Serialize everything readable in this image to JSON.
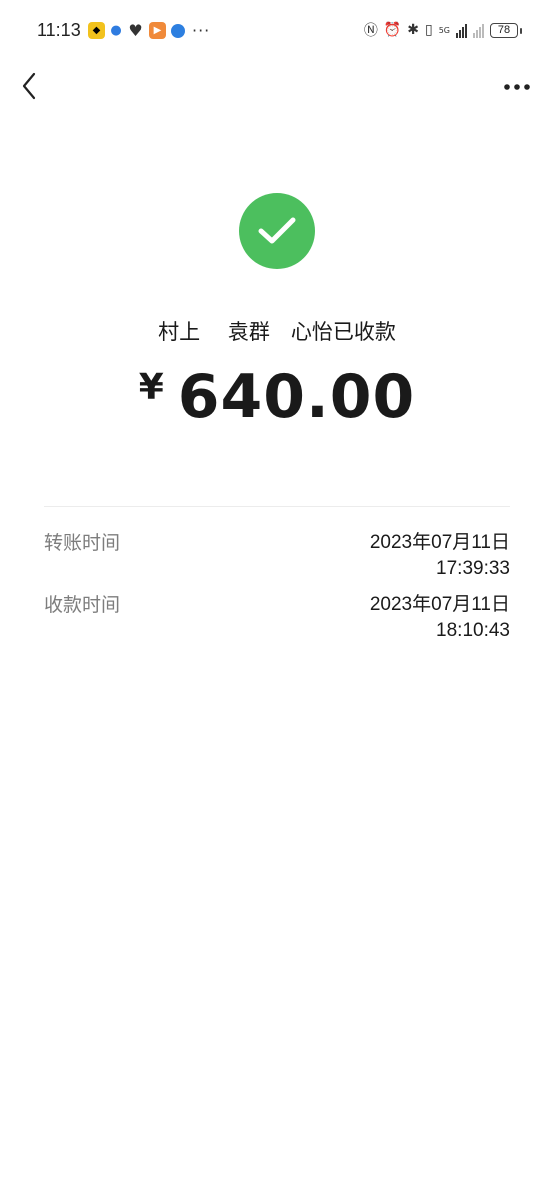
{
  "status_bar": {
    "time": "11:13",
    "more": "···",
    "battery": "78",
    "network": "5G"
  },
  "nav": {
    "back_icon": "chevron-left-icon",
    "more_icon": "more-horizontal-icon"
  },
  "result": {
    "receiver_text": "村上　 袁群　心怡已收款",
    "currency": "¥",
    "amount": "640.00",
    "status_color": "#4cbf5e"
  },
  "details": {
    "transfer_time_label": "转账时间",
    "transfer_date": "2023年07月11日",
    "transfer_clock": "17:39:33",
    "receive_time_label": "收款时间",
    "receive_date": "2023年07月11日",
    "receive_clock": "18:10:43"
  }
}
